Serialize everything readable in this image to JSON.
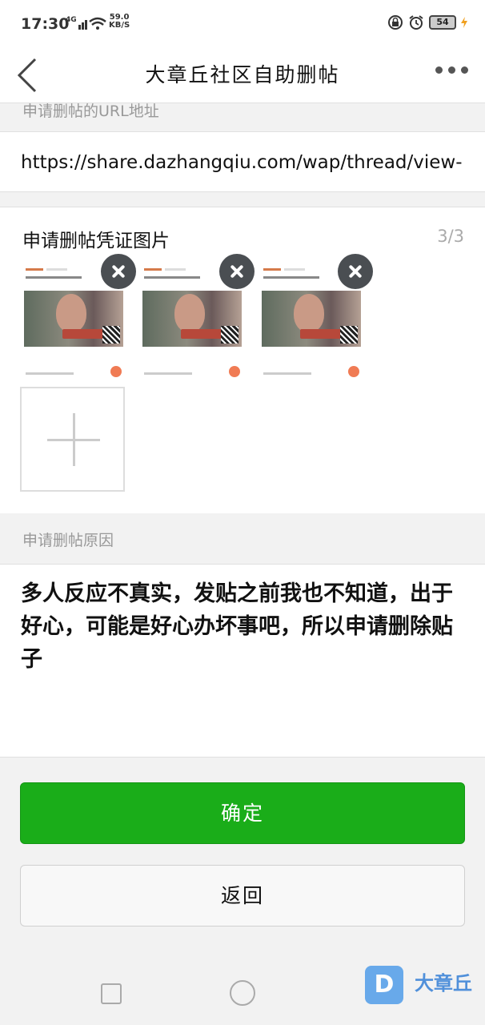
{
  "status_bar": {
    "time": "17:30",
    "network": "4G",
    "speed_value": "59.0",
    "speed_unit": "KB/S",
    "battery": "54"
  },
  "header": {
    "title": "大章丘社区自助删帖"
  },
  "url_section": {
    "label": "申请删帖的URL地址",
    "value": "https://share.dazhangqiu.com/wap/thread/view-"
  },
  "images_section": {
    "title": "申请删帖凭证图片",
    "count": "3/3",
    "thumbnails": [
      {
        "name": "thumbnail-1"
      },
      {
        "name": "thumbnail-2"
      },
      {
        "name": "thumbnail-3"
      }
    ]
  },
  "reason_section": {
    "label": "申请删帖原因",
    "text": "多人反应不真实，发贴之前我也不知道，出于好心，可能是好心办坏事吧，所以申请删除贴子"
  },
  "buttons": {
    "confirm": "确定",
    "back": "返回"
  },
  "watermark": {
    "logo_letter": "D",
    "text": "大章丘"
  },
  "colors": {
    "confirm_green": "#1aad19",
    "delete_badge": "#4a4e52"
  }
}
